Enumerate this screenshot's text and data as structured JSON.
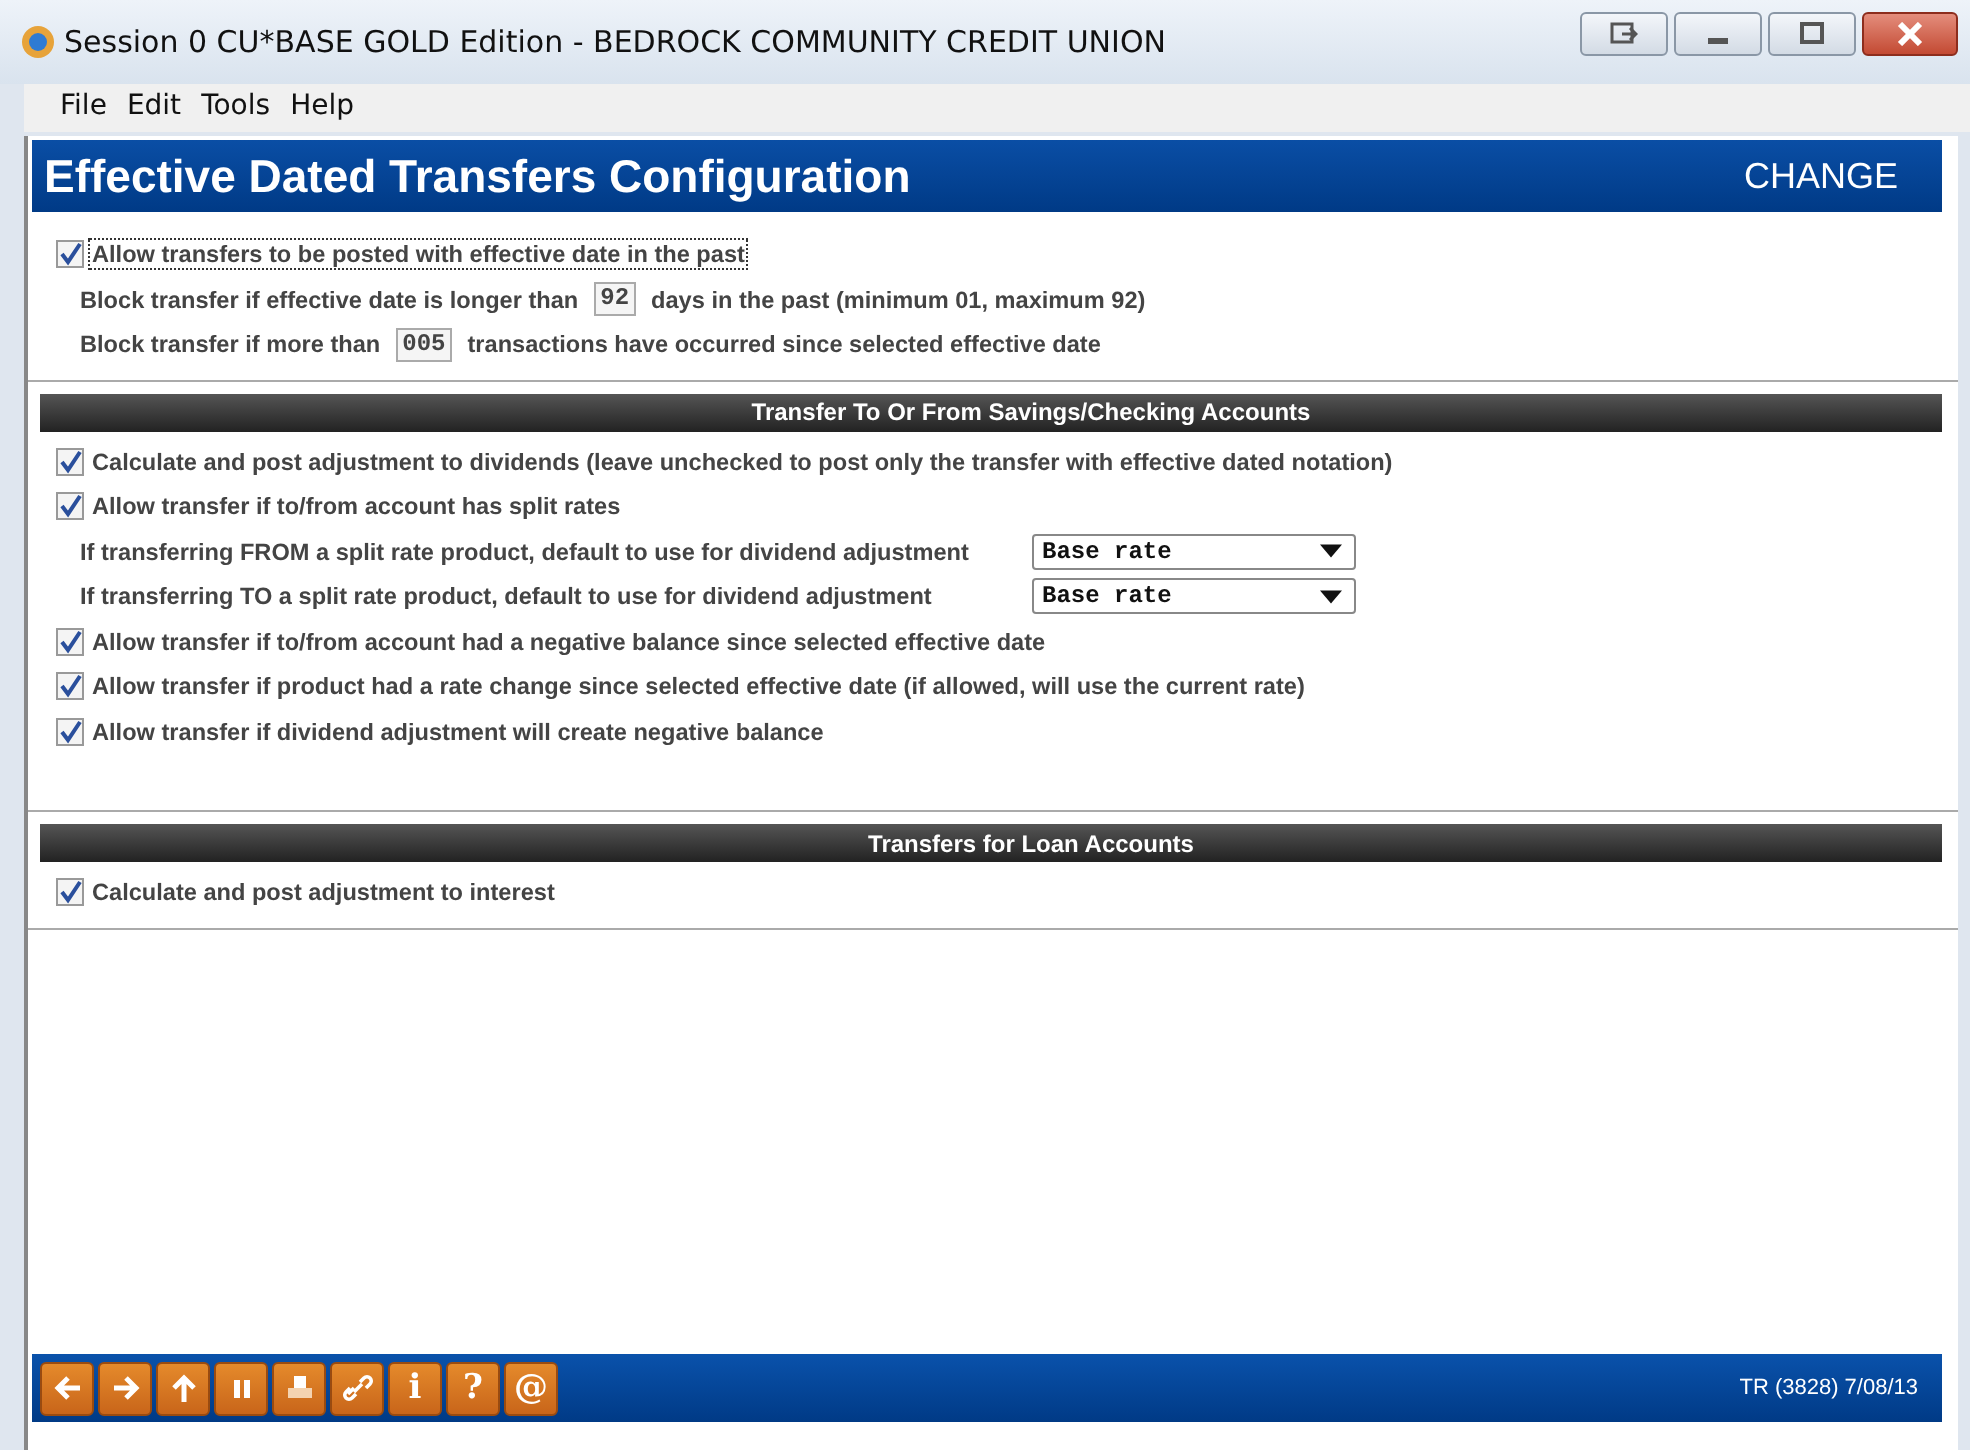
{
  "window": {
    "title": "Session 0 CU*BASE GOLD Edition - BEDROCK COMMUNITY CREDIT UNION"
  },
  "menu": [
    "File",
    "Edit",
    "Tools",
    "Help"
  ],
  "header": {
    "title": "Effective Dated Transfers Configuration",
    "mode": "CHANGE"
  },
  "groups": [
    {
      "items": [
        {
          "kind": "checkbox",
          "label": "Allow transfers to be posted with effective date in the past",
          "checked": true,
          "focused": true
        },
        {
          "kind": "field",
          "before": "Block transfer if effective date is longer than",
          "value": "92",
          "after": "days in the past (minimum 01, maximum 92)"
        },
        {
          "kind": "field",
          "before": "Block transfer if more than",
          "value": "005",
          "after": "transactions have occurred since selected effective date"
        }
      ]
    },
    {
      "title": "Transfer To Or From Savings/Checking Accounts",
      "items": [
        {
          "kind": "checkbox",
          "label": "Calculate and post adjustment to dividends (leave unchecked to post only the transfer with effective dated notation)",
          "checked": true,
          "focused": false
        },
        {
          "kind": "checkbox",
          "label": "Allow transfer if to/from account has split rates",
          "checked": true,
          "focused": false
        },
        {
          "kind": "select",
          "label": "If transferring FROM a split rate product, default to use for dividend adjustment",
          "value": "Base rate"
        },
        {
          "kind": "select",
          "label": "If transferring TO a split rate product, default to use for dividend adjustment",
          "value": "Base rate"
        },
        {
          "kind": "checkbox",
          "label": "Allow transfer if to/from account had a negative balance since selected effective date",
          "checked": true,
          "focused": false
        },
        {
          "kind": "checkbox",
          "label": "Allow transfer if product had a rate change since selected effective date (if allowed, will use the current rate)",
          "checked": true,
          "focused": false
        },
        {
          "kind": "checkbox",
          "label": "Allow transfer if dividend adjustment will create negative balance",
          "checked": true,
          "focused": false
        }
      ]
    },
    {
      "title": "Transfers for Loan Accounts",
      "items": [
        {
          "kind": "checkbox",
          "label": "Calculate and post adjustment to interest",
          "checked": true,
          "focused": false
        }
      ]
    }
  ],
  "toolbar": [
    {
      "kind": "back"
    },
    {
      "kind": "forward"
    },
    {
      "kind": "up"
    },
    {
      "kind": "pause"
    },
    {
      "kind": "print"
    },
    {
      "kind": "link"
    },
    {
      "kind": "text",
      "label": "i"
    },
    {
      "kind": "text",
      "label": "?"
    },
    {
      "kind": "text",
      "label": "@"
    }
  ],
  "status": "TR (3828) 7/08/13"
}
